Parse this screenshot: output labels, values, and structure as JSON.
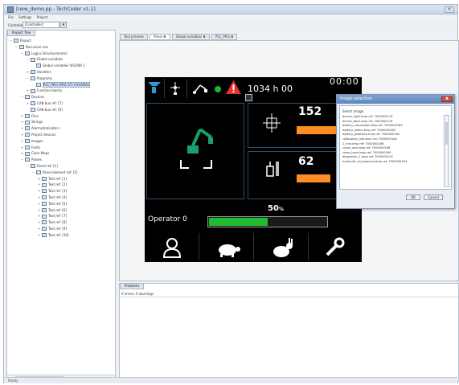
{
  "window": {
    "title": "[new_demo.pp - TechCoder v1.1]",
    "close_glyph": "×"
  },
  "menu": [
    "File",
    "Settings",
    "Project"
  ],
  "controller_bar": {
    "label": "Controller",
    "selected": "[Controller]",
    "arrow": "▾"
  },
  "left_panel": {
    "tab_label": "Project Tree",
    "tree": [
      {
        "label": "Project",
        "depth": 0,
        "expander": "−",
        "icon": "folder"
      },
      {
        "label": "Recursive nav",
        "depth": 1,
        "expander": "−",
        "icon": "module"
      },
      {
        "label": "Logics (Environments)",
        "depth": 2,
        "expander": "−",
        "icon": "folder"
      },
      {
        "label": "Global variables",
        "depth": 3,
        "expander": "−",
        "icon": "folder"
      },
      {
        "label": "Global variables VIGORA 1",
        "depth": 4,
        "expander": "",
        "icon": "file"
      },
      {
        "label": "Handlers",
        "depth": 3,
        "expander": "+",
        "icon": "folder"
      },
      {
        "label": "Programs",
        "depth": 3,
        "expander": "−",
        "icon": "folder"
      },
      {
        "label": "PLC_PRG (PRG-ST) [VIGORA]",
        "depth": 4,
        "expander": "",
        "icon": "file",
        "selected": true
      },
      {
        "label": "Function blocks",
        "depth": 3,
        "expander": "+",
        "icon": "folder"
      },
      {
        "label": "Devices",
        "depth": 2,
        "expander": "−",
        "icon": "folder"
      },
      {
        "label": "CAN bus ref: [7]",
        "depth": 3,
        "expander": "+",
        "icon": "bus"
      },
      {
        "label": "CAN bus ref: [6]",
        "depth": 3,
        "expander": "",
        "icon": "bus"
      },
      {
        "label": "Files",
        "depth": 2,
        "expander": "+",
        "icon": "file"
      },
      {
        "label": "Strings",
        "depth": 2,
        "expander": "+",
        "icon": "file"
      },
      {
        "label": "Alarms/Indicators",
        "depth": 2,
        "expander": "+",
        "icon": "gear"
      },
      {
        "label": "Project devices",
        "depth": 2,
        "expander": "+",
        "icon": "module"
      },
      {
        "label": "Images",
        "depth": 2,
        "expander": "+",
        "icon": "image"
      },
      {
        "label": "Fonts",
        "depth": 2,
        "expander": "+",
        "icon": "font"
      },
      {
        "label": "Color Maps",
        "depth": 2,
        "expander": "+",
        "icon": "color"
      },
      {
        "label": "Panels",
        "depth": 2,
        "expander": "−",
        "icon": "folder"
      },
      {
        "label": "Panel ref: [1]",
        "depth": 3,
        "expander": "−",
        "icon": "panel"
      },
      {
        "label": "Panel element ref: [1]",
        "depth": 4,
        "expander": "−",
        "icon": "panel"
      },
      {
        "label": "Text ref: [1]",
        "depth": 5,
        "expander": "+",
        "icon": "text"
      },
      {
        "label": "Text ref: [2]",
        "depth": 5,
        "expander": "+",
        "icon": "text"
      },
      {
        "label": "Text ref: [3]",
        "depth": 5,
        "expander": "+",
        "icon": "text"
      },
      {
        "label": "Text ref: [4]",
        "depth": 5,
        "expander": "+",
        "icon": "text"
      },
      {
        "label": "Text ref: [5]",
        "depth": 5,
        "expander": "+",
        "icon": "text"
      },
      {
        "label": "Text ref: [6]",
        "depth": 5,
        "expander": "+",
        "icon": "text"
      },
      {
        "label": "Text ref: [7]",
        "depth": 5,
        "expander": "+",
        "icon": "text"
      },
      {
        "label": "Text ref: [8]",
        "depth": 5,
        "expander": "+",
        "icon": "text"
      },
      {
        "label": "Text ref: [9]",
        "depth": 5,
        "expander": "+",
        "icon": "text"
      },
      {
        "label": "Text ref: [10]",
        "depth": 5,
        "expander": "+",
        "icon": "text"
      }
    ]
  },
  "editor": {
    "tabs": [
      {
        "label": "Tool preview",
        "active": false
      },
      {
        "label": "Panel ✖",
        "active": true
      },
      {
        "label": "Global variables ✖",
        "active": false
      },
      {
        "label": "PLC_PRG ✖",
        "active": false
      }
    ],
    "hmi": {
      "hours": "1034 h",
      "hours_suffix": "00",
      "clock": "00:00",
      "value_top": "152",
      "value_top_bar_fraction": 0.65,
      "value_bottom": "62",
      "value_bottom_bar_fraction": 0.55,
      "speed_percent": "50",
      "percent_sign": "%",
      "speed_fraction": 0.5,
      "operator": "Operator 0",
      "colors": {
        "background": "#000000",
        "accent_orange": "#ff8d24",
        "green": "#1db33a",
        "warning_red": "#e5322b",
        "logo_blue": "#2a9ad8"
      }
    }
  },
  "dialog": {
    "title": "Image selection",
    "close_glyph": "✖",
    "list_title": "Select image",
    "items": [
      "device_right.bmp ref: 7000000176",
      "device_back.bmp ref: 7000000178",
      "battery_calculation.bmp ref: 7000000180",
      "battery_select.bmp ref: 7000000180",
      "battery_positions.bmp ref: 7000000182",
      "calibration_info.bmp ref: 7000000184",
      "1_mm.bmp ref: 7000000186",
      "crane_arm.bmp ref: 7000000188",
      "cross_track.bmp ref: 7000000190",
      "diagnostic_1.bmp ref: 7000000192",
      "hydraulic_oil_pressure.bmp ref: 7000000194"
    ],
    "ok_label": "OK",
    "cancel_label": "Cancel"
  },
  "problems": {
    "tab_label": "Problems",
    "count_text": "0 errors, 0 warnings"
  },
  "statusbar": {
    "text": "Ready"
  }
}
